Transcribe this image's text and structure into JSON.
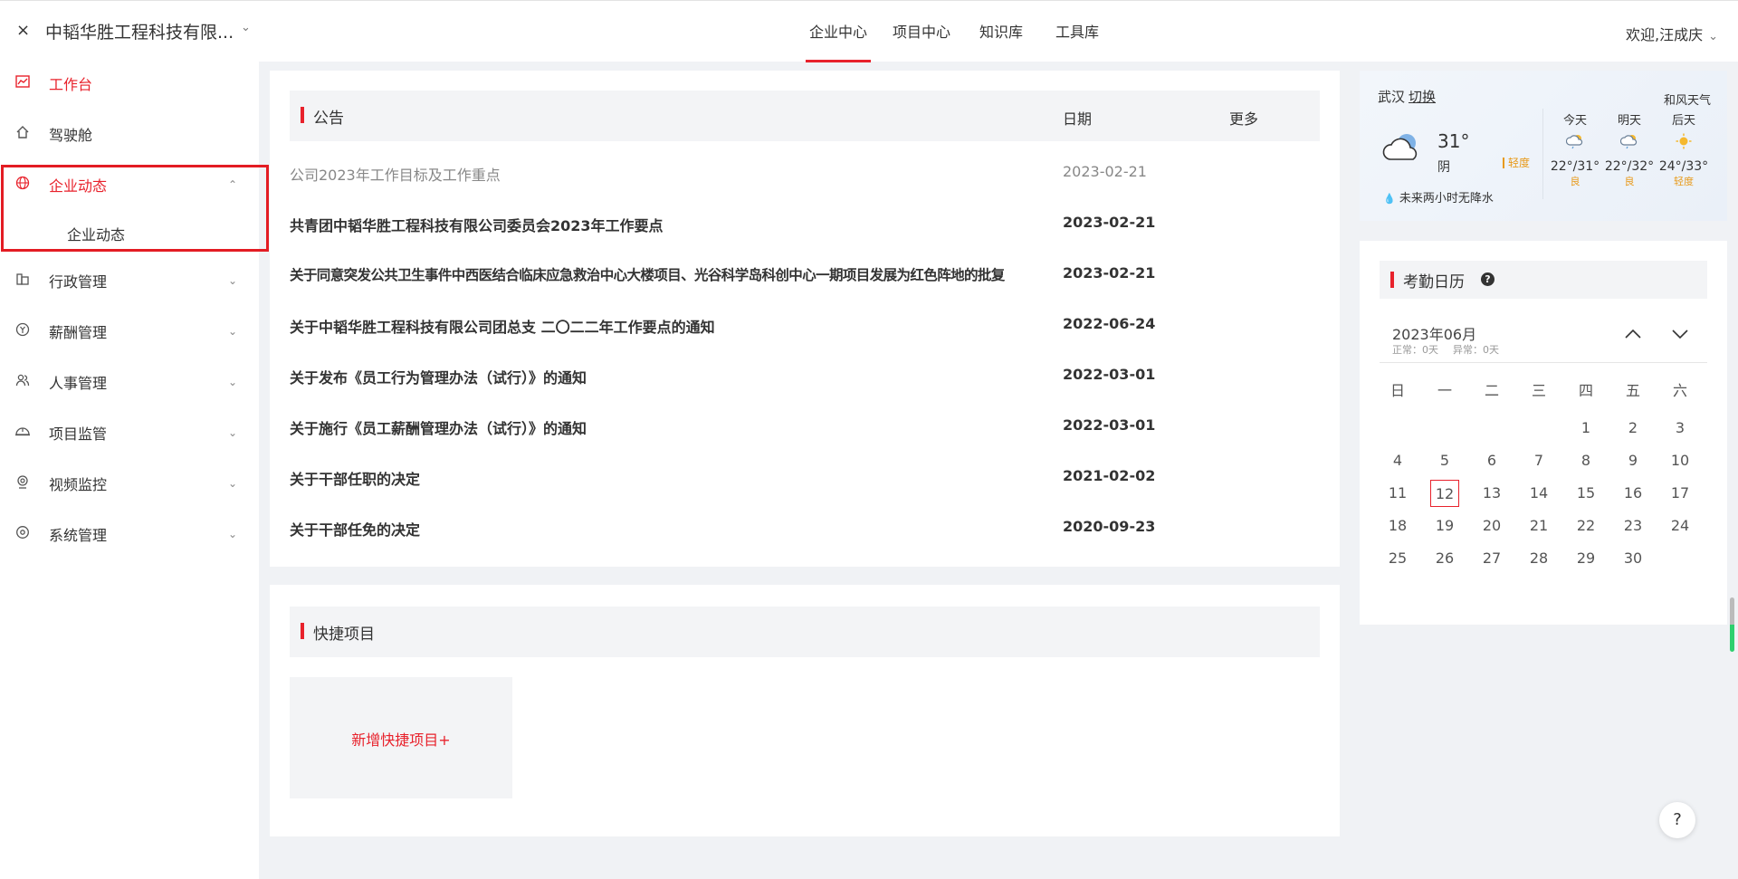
{
  "header": {
    "close": "×",
    "company": "中韬华胜工程科技有限...",
    "tabs": [
      {
        "label": "企业中心"
      },
      {
        "label": "项目中心"
      },
      {
        "label": "知识库"
      },
      {
        "label": "工具库"
      }
    ],
    "welcome": "欢迎,汪成庆"
  },
  "sidebar": {
    "items": [
      {
        "label": "工作台",
        "icon": "chart-line-icon"
      },
      {
        "label": "驾驶舱",
        "icon": "home-icon"
      },
      {
        "label": "企业动态",
        "icon": "globe-icon"
      },
      {
        "label": "行政管理",
        "icon": "building-icon"
      },
      {
        "label": "薪酬管理",
        "icon": "salary-icon"
      },
      {
        "label": "人事管理",
        "icon": "people-icon"
      },
      {
        "label": "项目监管",
        "icon": "helmet-icon"
      },
      {
        "label": "视频监控",
        "icon": "camera-icon"
      },
      {
        "label": "系统管理",
        "icon": "settings-icon"
      }
    ],
    "subitem": "企业动态"
  },
  "notice": {
    "title": "公告",
    "date_header": "日期",
    "more": "更多",
    "rows": [
      {
        "title": "公司2023年工作目标及工作重点",
        "date": "2023-02-21"
      },
      {
        "title": "共青团中韬华胜工程科技有限公司委员会2023年工作要点",
        "date": "2023-02-21"
      },
      {
        "title": "关于同意突发公共卫生事件中西医结合临床应急救治中心大楼项目、光谷科学岛科创中心一期项目发展为红色阵地的批复",
        "date": "2023-02-21"
      },
      {
        "title": "关于中韬华胜工程科技有限公司团总支 二〇二二年工作要点的通知",
        "date": "2022-06-24"
      },
      {
        "title": "关于发布《员工行为管理办法（试行）》的通知",
        "date": "2022-03-01"
      },
      {
        "title": "关于施行《员工薪酬管理办法（试行）》的通知",
        "date": "2022-03-01"
      },
      {
        "title": "关于干部任职的决定",
        "date": "2021-02-02"
      },
      {
        "title": "关于干部任免的决定",
        "date": "2020-09-23"
      }
    ]
  },
  "quick": {
    "title": "快捷项目",
    "add_label": "新增快捷项目+"
  },
  "weather": {
    "city": "武汉",
    "switch": "切换",
    "brand": "和风天气",
    "temp": "31°",
    "condition": "阴",
    "aqi": "轻度",
    "rain": "未来两小时无降水",
    "days": [
      {
        "name": "今天",
        "icon": "cloud-sun-rain-icon",
        "range": "22°/31°",
        "quality": "良"
      },
      {
        "name": "明天",
        "icon": "cloud-sun-rain-icon",
        "range": "22°/32°",
        "quality": "良"
      },
      {
        "name": "后天",
        "icon": "sun-icon",
        "range": "24°/33°",
        "quality": "轻度"
      }
    ]
  },
  "calendar": {
    "title": "考勤日历",
    "month": "2023年06月",
    "normal": "正常：0天",
    "abnormal": "异常：0天",
    "weekdays": [
      "日",
      "一",
      "二",
      "三",
      "四",
      "五",
      "六"
    ],
    "first_weekday": 4,
    "days_in_month": 30,
    "today": 12
  },
  "help": "?",
  "colors": {
    "accent": "#e8222c",
    "warning": "#e89a1a"
  }
}
